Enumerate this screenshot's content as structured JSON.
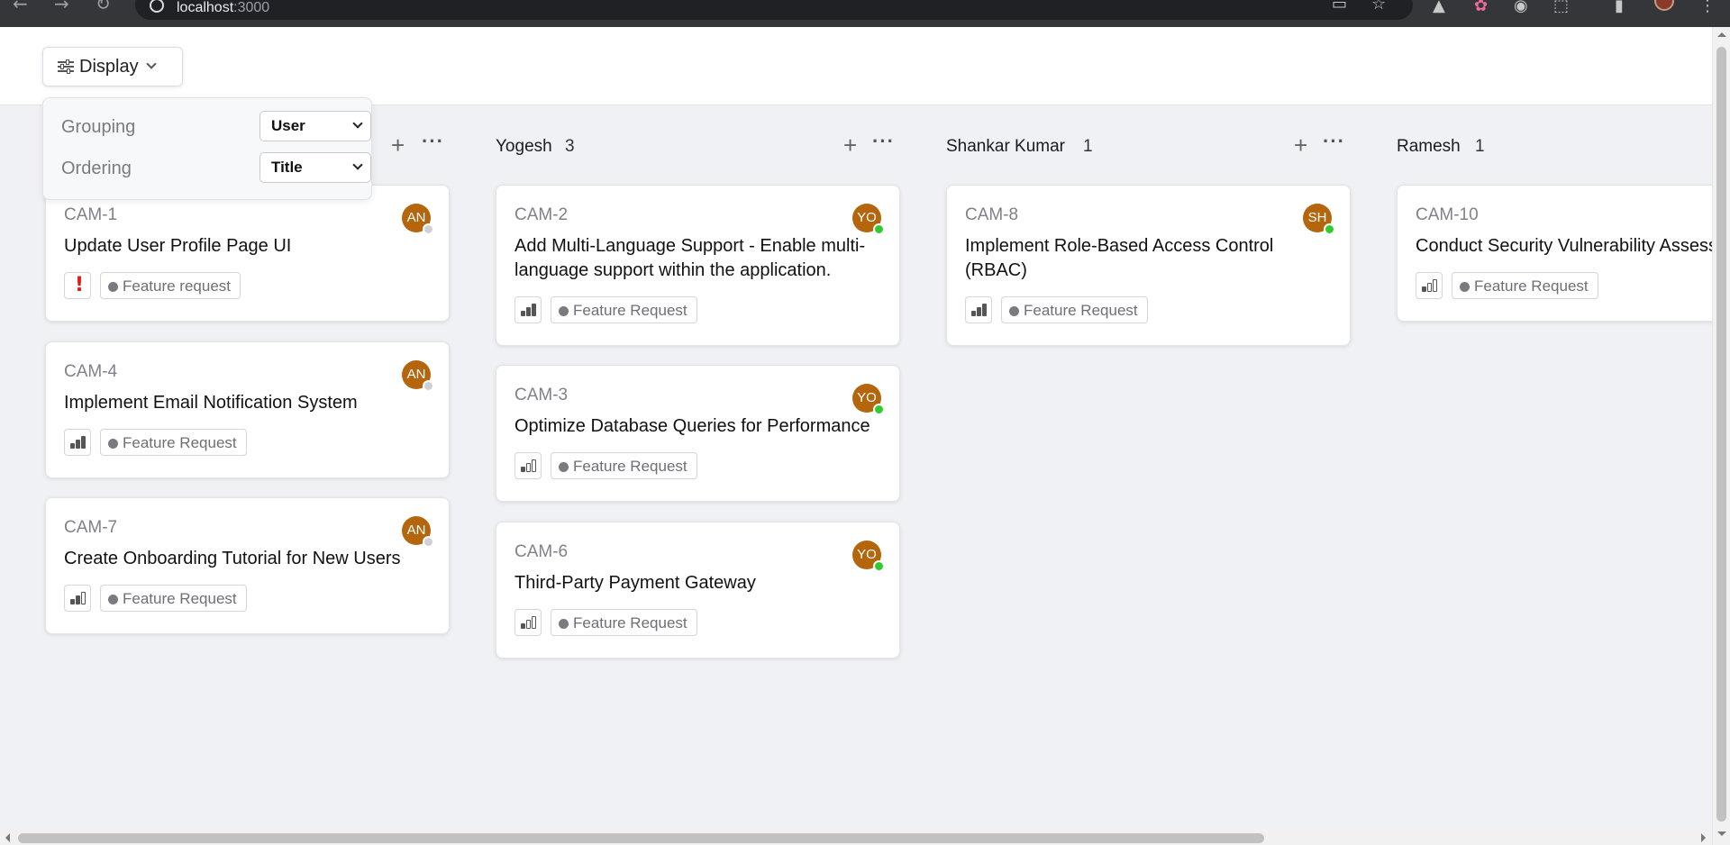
{
  "browser": {
    "url_host": "localhost",
    "url_port": ":3000"
  },
  "display_menu": {
    "button_label": "Display",
    "grouping_label": "Grouping",
    "grouping_value": "User",
    "ordering_label": "Ordering",
    "ordering_value": "Title"
  },
  "columns": [
    {
      "name": "",
      "count": "",
      "cards": [
        {
          "id": "CAM-1",
          "title": "Update User Profile Page UI",
          "avatar": "AN",
          "online": false,
          "priority": "urgent",
          "tag": "Feature request"
        },
        {
          "id": "CAM-4",
          "title": "Implement Email Notification System",
          "avatar": "AN",
          "online": false,
          "priority": "high",
          "tag": "Feature Request"
        },
        {
          "id": "CAM-7",
          "title": "Create Onboarding Tutorial for New Users",
          "avatar": "AN",
          "online": false,
          "priority": "medium",
          "tag": "Feature Request"
        }
      ]
    },
    {
      "name": "Yogesh",
      "count": "3",
      "cards": [
        {
          "id": "CAM-2",
          "title": "Add Multi-Language Support - Enable multi-language support within the application.",
          "avatar": "YO",
          "online": true,
          "priority": "high",
          "tag": "Feature Request"
        },
        {
          "id": "CAM-3",
          "title": "Optimize Database Queries for Performance",
          "avatar": "YO",
          "online": true,
          "priority": "low",
          "tag": "Feature Request"
        },
        {
          "id": "CAM-6",
          "title": "Third-Party Payment Gateway",
          "avatar": "YO",
          "online": true,
          "priority": "low",
          "tag": "Feature Request"
        }
      ]
    },
    {
      "name": "Shankar Kumar",
      "count": "1",
      "cards": [
        {
          "id": "CAM-8",
          "title": "Implement Role-Based Access Control (RBAC)",
          "avatar": "SH",
          "online": true,
          "priority": "high",
          "tag": "Feature Request"
        }
      ]
    },
    {
      "name": "Ramesh",
      "count": "1",
      "cards": [
        {
          "id": "CAM-10",
          "title": "Conduct Security Vulnerability Assessment",
          "avatar": "",
          "online": false,
          "priority": "low",
          "tag": "Feature Request"
        }
      ]
    }
  ],
  "colors": {
    "avatar": "#b5660d",
    "online": "#2ecc2e",
    "offline": "#d0d1d6",
    "urgent": "#e21b1b",
    "bar_dark": "#555555"
  },
  "icons": {
    "add": "plus-icon",
    "more": "ellipsis-icon",
    "display": "sliders-icon",
    "dropdown": "chevron-down-icon"
  }
}
